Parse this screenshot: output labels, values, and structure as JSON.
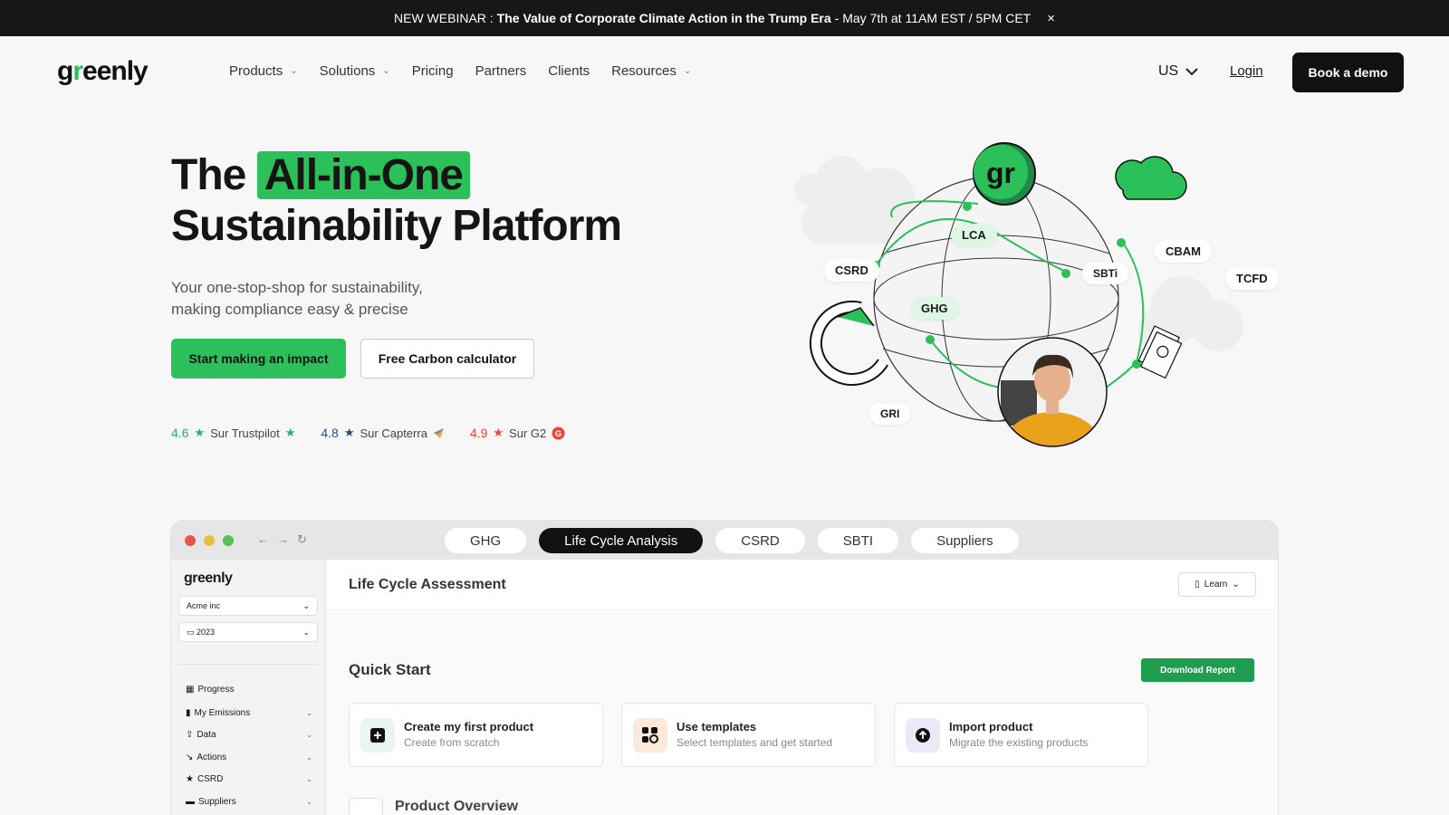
{
  "banner": {
    "prefix": "NEW WEBINAR :",
    "title": "The Value of Corporate Climate Action in the Trump Era",
    "suffix": "- May 7th at 11AM EST / 5PM CET",
    "close": "×"
  },
  "nav": {
    "logo": "greenly",
    "items": [
      "Products",
      "Solutions",
      "Pricing",
      "Partners",
      "Clients",
      "Resources"
    ],
    "lang": "US",
    "login": "Login",
    "demo": "Book a demo"
  },
  "hero": {
    "title_pre": "The",
    "title_hl": "All-in-One",
    "title_line2": "Sustainability Platform",
    "sub_line1": "Your one-stop-shop for sustainability,",
    "sub_line2": "making compliance easy & precise",
    "btn_primary": "Start making an impact",
    "btn_secondary": "Free Carbon calculator",
    "ratings": [
      {
        "score": "4.6",
        "label": "Sur Trustpilot",
        "color": "#2cae66"
      },
      {
        "score": "4.8",
        "label": "Sur Capterra",
        "color": "#1f4f8f"
      },
      {
        "score": "4.9",
        "label": "Sur G2",
        "color": "#e8463a"
      }
    ]
  },
  "illustration": {
    "labels": [
      "LCA",
      "CSRD",
      "SBTi",
      "CBAM",
      "TCFD",
      "GHG",
      "GRI"
    ],
    "badge": "gr"
  },
  "app": {
    "tabs": [
      "GHG",
      "Life Cycle Analysis",
      "CSRD",
      "SBTI",
      "Suppliers"
    ],
    "active_tab": "Life Cycle Analysis",
    "sidebar": {
      "logo": "greenly",
      "company": "Acme inc",
      "year": "2023",
      "items": [
        "Progress",
        "My Emissions",
        "Data",
        "Actions",
        "CSRD",
        "Suppliers"
      ]
    },
    "header": {
      "title": "Life Cycle Assessment",
      "learn": "Learn"
    },
    "quick_start": "Quick Start",
    "download": "Download Report",
    "cards": [
      {
        "title": "Create my first product",
        "sub": "Create from scratch"
      },
      {
        "title": "Use templates",
        "sub": "Select templates and get started"
      },
      {
        "title": "Import product",
        "sub": "Migrate the existing products"
      }
    ],
    "product_overview": "Product Overview"
  }
}
